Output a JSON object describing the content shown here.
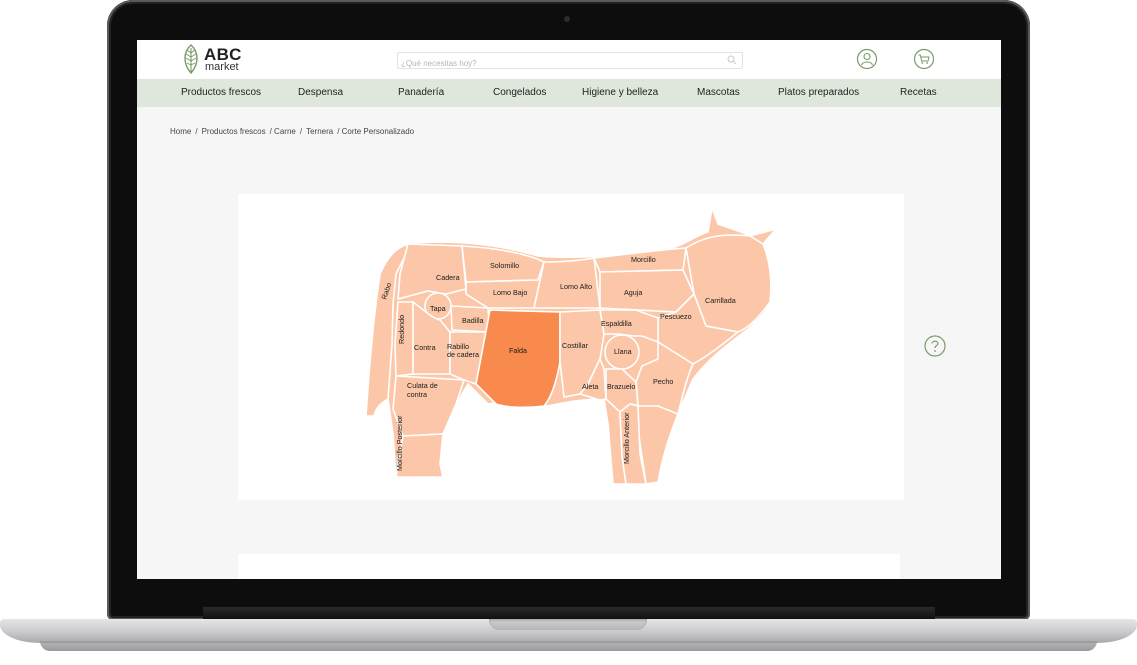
{
  "brand": {
    "abc": "ABC",
    "market": "market"
  },
  "search": {
    "placeholder": "¿Qué necesitas hoy?"
  },
  "nav": [
    "Productos frescos",
    "Despensa",
    "Panadería",
    "Congelados",
    "Higiene y belleza",
    "Mascotas",
    "Platos preparados",
    "Recetas"
  ],
  "breadcrumb": [
    "Home",
    "/",
    "Productos frescos",
    "/ Carne",
    "/",
    "Ternera",
    "/ Corte Personalizado"
  ],
  "cuts": {
    "rabo": "Rabo",
    "cadera": "Cadera",
    "solomillo": "Solomillo",
    "lomo_bajo": "Lomo Bajo",
    "lomo_alto": "Lomo Alto",
    "morcillo": "Morcillo",
    "aguja": "Aguja",
    "carrillada": "Carrillada",
    "tapa": "Tapa",
    "badilla": "Badilla",
    "redondo": "Redondo",
    "contra": "Contra",
    "rabillo_line1": "Rabillo",
    "rabillo_line2": "de cadera",
    "falda": "Falda",
    "costillar": "Costillar",
    "espaldilla": "Espaldilla",
    "pescuezo": "Pescuezo",
    "llana": "Llana",
    "culata_line1": "Culata de",
    "culata_line2": "contra",
    "aleta": "Aleta",
    "brazuelo": "Brazuelo",
    "pecho": "Pecho",
    "morcillo_posterior": "Morcillo Posterior",
    "morcillo_anterior": "Morcillo Anterior"
  },
  "selected_cut": "Falda",
  "colors": {
    "cut_fill": "#fcc7a8",
    "cut_selected": "#f98a4e",
    "nav_bg": "#dfe7dc",
    "brand_green": "#7a9a6a"
  },
  "icons": [
    "leaf-logo-icon",
    "search-icon",
    "user-icon",
    "cart-icon",
    "help-icon"
  ]
}
